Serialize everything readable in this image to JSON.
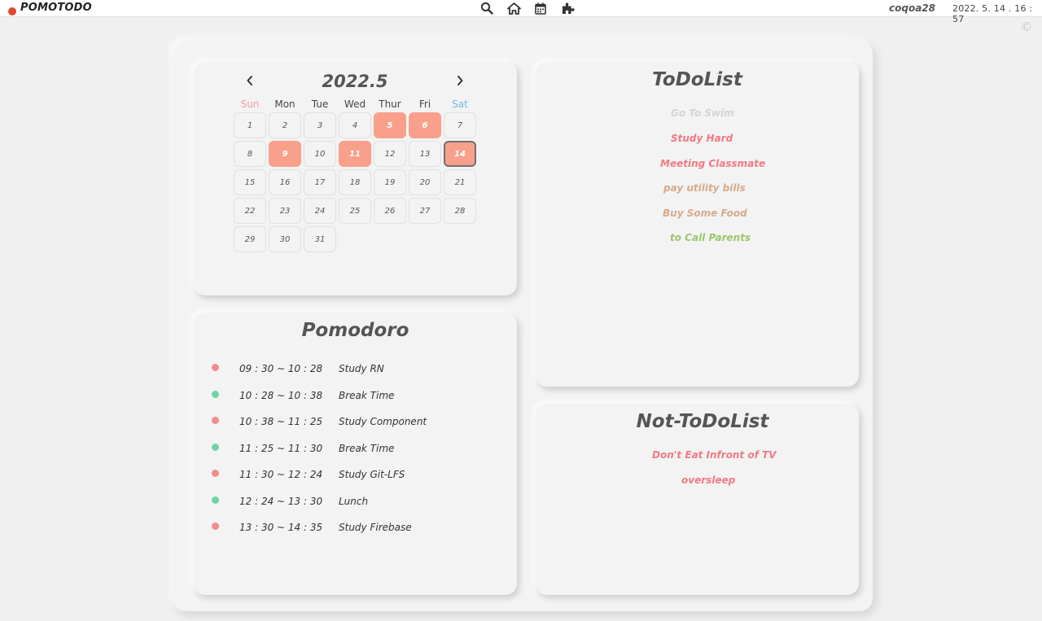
{
  "app": {
    "title": "POMOTODO",
    "username": "coqoa28",
    "datetime": "2022. 5. 14 . 16 : 57"
  },
  "nav": {
    "icons": [
      "search-icon",
      "home-icon",
      "calendar-icon",
      "puzzle-icon"
    ]
  },
  "colors": {
    "highlight_day": "#f8a08c",
    "work_dot": "#f28b8b",
    "rest_dot": "#6fd3a6",
    "sunday": "#f29aa6",
    "saturday": "#6fb8e2"
  },
  "calendar": {
    "title": "2022.5",
    "weekdays": [
      "Sun",
      "Mon",
      "Tue",
      "Wed",
      "Thur",
      "Fri",
      "Sat"
    ],
    "days": [
      "1",
      "2",
      "3",
      "4",
      "5",
      "6",
      "7",
      "8",
      "9",
      "10",
      "11",
      "12",
      "13",
      "14",
      "15",
      "16",
      "17",
      "18",
      "19",
      "20",
      "21",
      "22",
      "23",
      "24",
      "25",
      "26",
      "27",
      "28",
      "29",
      "30",
      "31"
    ],
    "highlighted_days": [
      "5",
      "6",
      "9",
      "11",
      "14"
    ],
    "today": "14"
  },
  "pomodoro": {
    "title": "Pomodoro",
    "entries": [
      {
        "time": "09 : 30 ~ 10 : 28",
        "task": "Study RN",
        "kind": "work"
      },
      {
        "time": "10 : 28 ~ 10 : 38",
        "task": "Break Time",
        "kind": "rest"
      },
      {
        "time": "10 : 38 ~ 11 : 25",
        "task": "Study Component",
        "kind": "work"
      },
      {
        "time": "11 : 25 ~ 11 : 30",
        "task": "Break Time",
        "kind": "rest"
      },
      {
        "time": "11 : 30 ~ 12 : 24",
        "task": "Study Git-LFS",
        "kind": "work"
      },
      {
        "time": "12 : 24 ~ 13 : 30",
        "task": "Lunch",
        "kind": "rest"
      },
      {
        "time": "13 : 30 ~ 14 : 35",
        "task": "Study Firebase",
        "kind": "work"
      }
    ]
  },
  "todo": {
    "title": "ToDoList",
    "items": [
      {
        "label": "Go To Swim",
        "color": "#d4d4d4"
      },
      {
        "label": "Study Hard",
        "color": "#f07a84"
      },
      {
        "label": "Meeting Classmate",
        "color": "#f07a84"
      },
      {
        "label": "pay utility bills",
        "color": "#d8a98a"
      },
      {
        "label": "Buy Some Food",
        "color": "#d8a98a"
      },
      {
        "label": "to Call Parents",
        "color": "#9cc76a"
      }
    ]
  },
  "nottodo": {
    "title": "Not-ToDoList",
    "items": [
      {
        "label": "Don't Eat Infront of TV",
        "color": "#f07a84"
      },
      {
        "label": "oversleep",
        "color": "#f07a84"
      }
    ]
  }
}
